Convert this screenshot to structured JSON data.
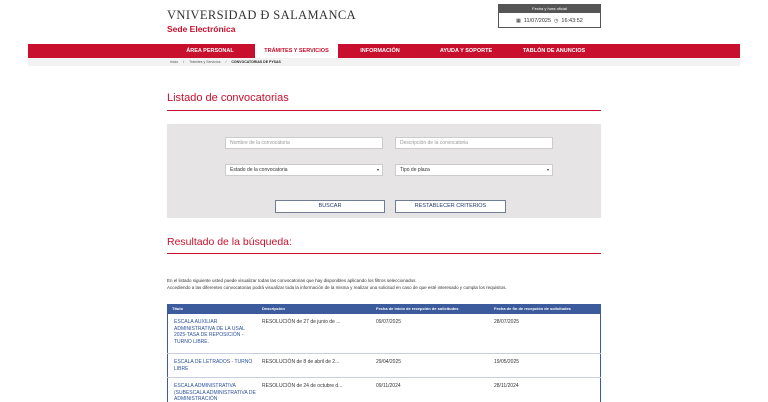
{
  "header": {
    "brand": "VNIVERSIDAD Ð SALAMANCA",
    "subtitle": "Sede Electrónica",
    "clock": {
      "label": "Fecha y hora oficial",
      "date": "11/07/2025",
      "time": "16:43:52"
    }
  },
  "nav": {
    "items": [
      {
        "label": "ÁREA PERSONAL"
      },
      {
        "label": "TRÁMITES Y SERVICIOS"
      },
      {
        "label": "INFORMACIÓN"
      },
      {
        "label": "AYUDA Y SOPORTE"
      },
      {
        "label": "TABLÓN DE ANUNCIOS"
      }
    ]
  },
  "breadcrumb": {
    "home": "Inicio",
    "sep": "/",
    "section": "Trámites y Servicios",
    "current": "CONVOCATORIAS DE PYSAS"
  },
  "page": {
    "title": "Listado de convocatorias"
  },
  "filters": {
    "name_placeholder": "Nombre de la convocatoria",
    "desc_placeholder": "Descripción de la convocatoria",
    "state_select": "Estado de la convocatoria",
    "type_select": "Tipo de plaza",
    "search_label": "BUSCAR",
    "reset_label": "RESTABLECER CRITERIOS"
  },
  "results": {
    "title": "Resultado de la búsqueda:",
    "intro1": "En el listado siguiente usted puede visualizar todas las convocatorias que hay disponibles aplicando los filtros seleccionados.",
    "intro2": "Accediendo a las diferentes convocatorias podrá visualizar toda la información de la misma y realizar una solicitud en caso de que esté interesado y cumpla los requisitos."
  },
  "table": {
    "headers": [
      "Título",
      "Descripción",
      "Fecha de inicio de recepción de solicitudes",
      "Fecha de fin de recepción de solicitudes"
    ],
    "rows": [
      {
        "title": "ESCALA AUXILIAR ADMINISTRATIVA DE LA USAL 2025-TASA DE REPOSICIÓN - TURNO LIBRE.",
        "desc": "RESOLUCIÓN de 27 de junio de ...",
        "start": "09/07/2025",
        "end": "28/07/2025"
      },
      {
        "title": "ESCALA DE LETRADOS - TURNO LIBRE",
        "desc": "RESOLUCIÓN de 8 de abril de 2...",
        "start": "29/04/2025",
        "end": "19/05/2025"
      },
      {
        "title": "ESCALA ADMINISTRATIVA (SUBESCALA ADMINISTRATIVA DE ADMINISTRACIÓN",
        "desc": "RESOLUCIÓN de 24 de octubre d...",
        "start": "09/11/2024",
        "end": "28/11/2024"
      }
    ]
  },
  "colors": {
    "brand_red": "#c8102e",
    "table_header": "#3b5b9d",
    "link_blue": "#2a4f9a"
  }
}
